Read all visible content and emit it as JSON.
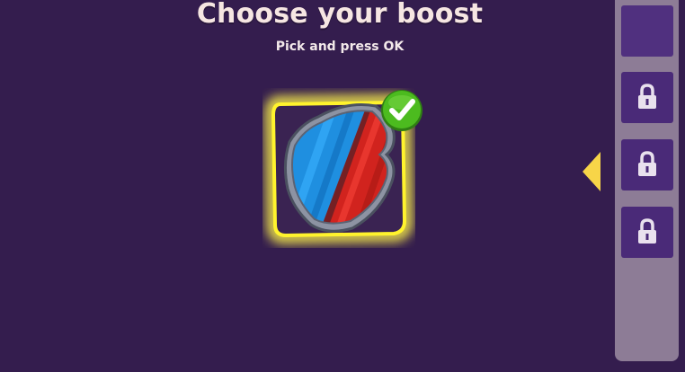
{
  "header": {
    "title": "Choose your boost",
    "subtitle": "Pick and press OK"
  },
  "boost": {
    "name_icon": "shield-icon",
    "selected": true,
    "colors": {
      "glow": "#fff32d",
      "shield_blue": "#1f8fe0",
      "shield_red": "#d1231e",
      "check_green": "#4cbb1f"
    }
  },
  "side_panel": {
    "slots": [
      {
        "state": "empty"
      },
      {
        "state": "locked",
        "icon": "lock-icon"
      },
      {
        "state": "locked",
        "icon": "lock-icon"
      },
      {
        "state": "locked",
        "icon": "lock-icon"
      }
    ],
    "arrow_icon": "arrow-left-icon",
    "arrow_color": "#f7d548"
  },
  "colors": {
    "background": "#341d4e",
    "panel": "#8d7c96",
    "slot": "#4a2a78"
  }
}
